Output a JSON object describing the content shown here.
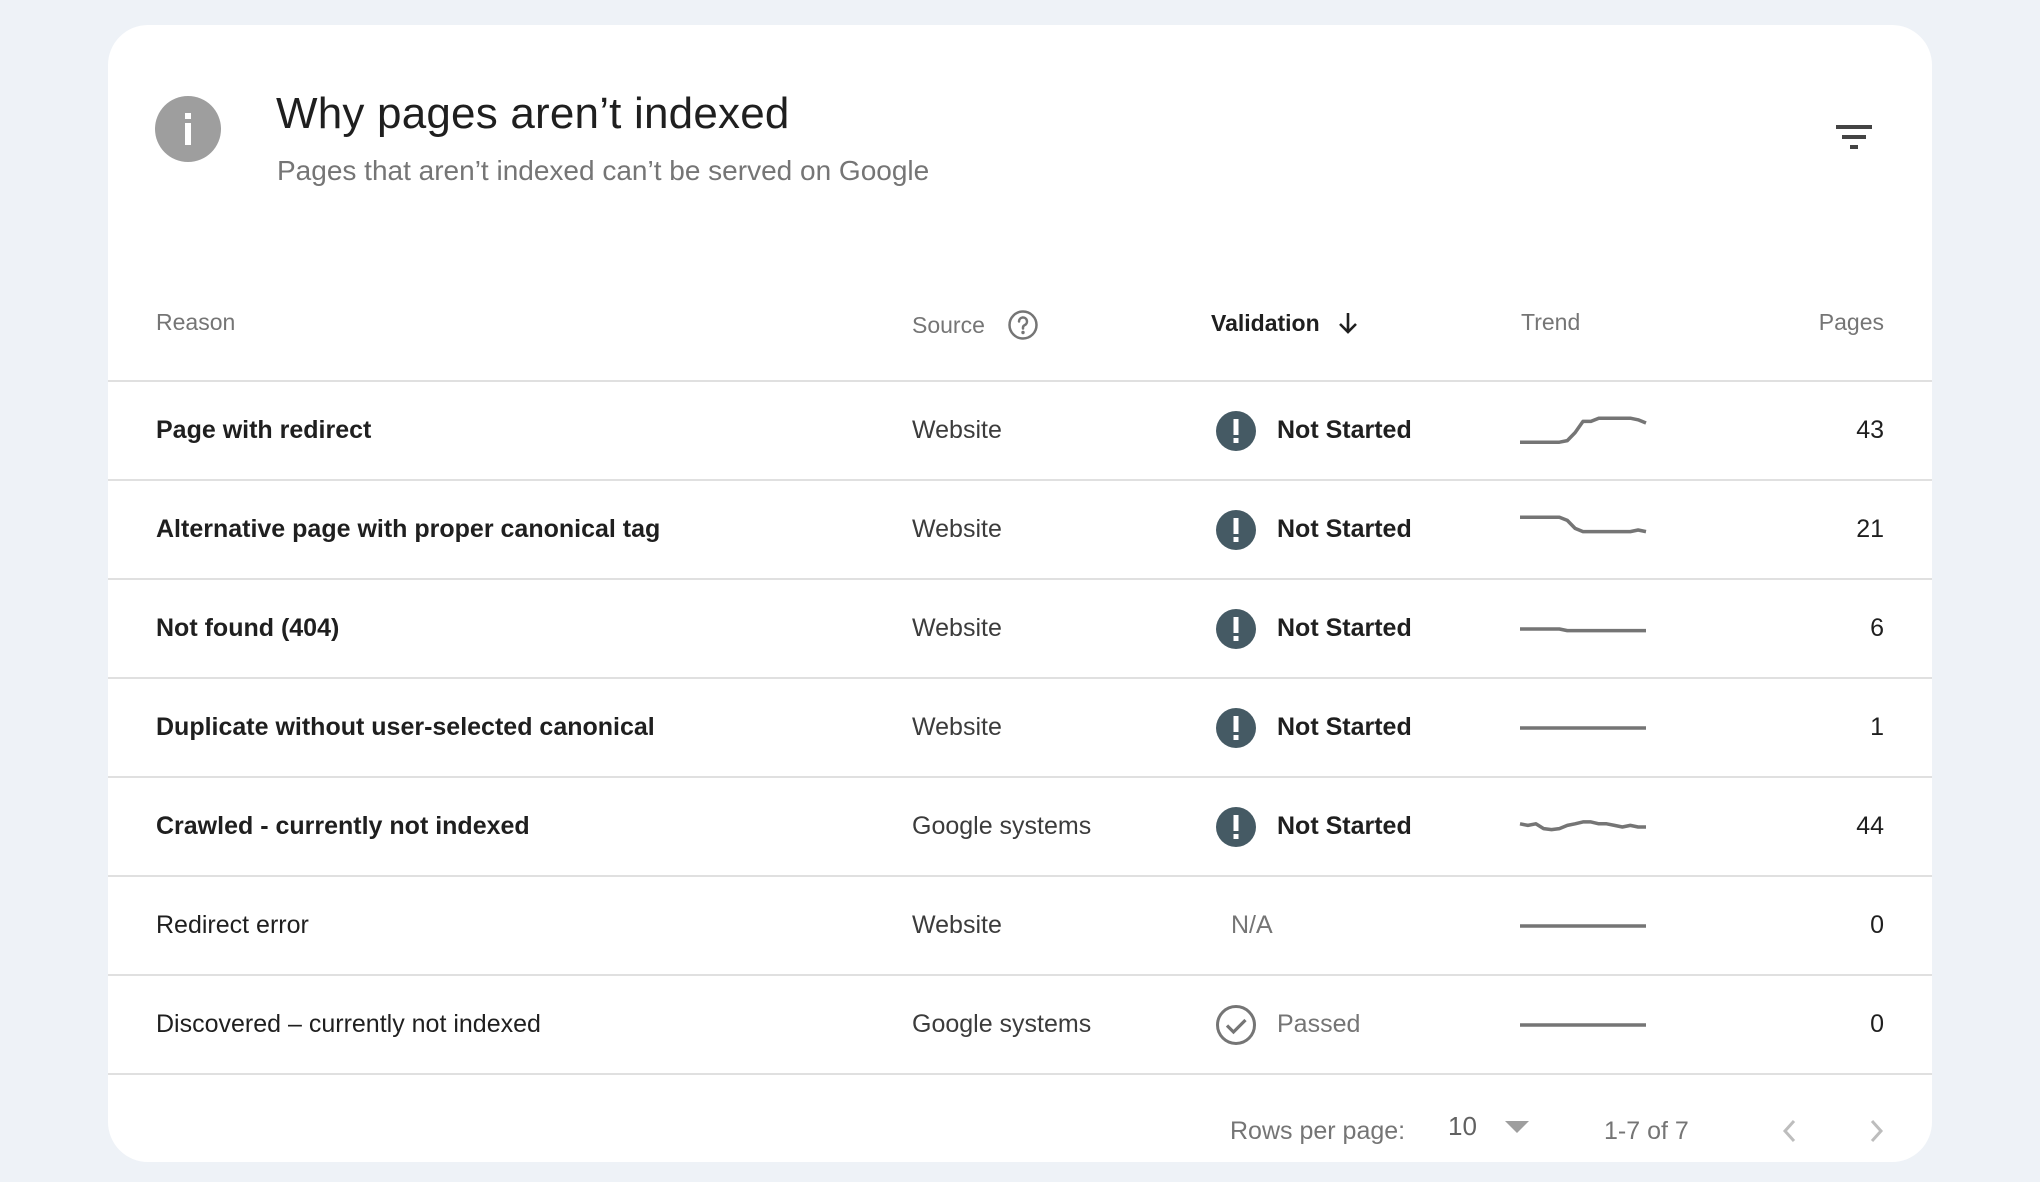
{
  "header": {
    "icon": "info-icon",
    "title": "Why pages aren’t indexed",
    "subtitle": "Pages that aren’t indexed can’t be served on Google",
    "filter_icon": "filter-icon"
  },
  "table": {
    "columns": {
      "reason": "Reason",
      "source": "Source",
      "validation": "Validation",
      "trend": "Trend",
      "pages": "Pages"
    },
    "sorted_by": "validation",
    "sort_direction": "descending",
    "rows": [
      {
        "reason": "Page with redirect",
        "source": "Website",
        "validation": "Not Started",
        "status": "not-started",
        "pages": "43",
        "trend": [
          0.15,
          0.15,
          0.15,
          0.15,
          0.15,
          0.15,
          0.2,
          0.45,
          0.8,
          0.8,
          0.9,
          0.9,
          0.9,
          0.9,
          0.9,
          0.85,
          0.75
        ]
      },
      {
        "reason": "Alternative page with proper canonical tag",
        "source": "Website",
        "validation": "Not Started",
        "status": "not-started",
        "pages": "21",
        "trend": [
          0.9,
          0.9,
          0.9,
          0.9,
          0.9,
          0.9,
          0.8,
          0.55,
          0.45,
          0.45,
          0.45,
          0.45,
          0.45,
          0.45,
          0.45,
          0.5,
          0.45
        ]
      },
      {
        "reason": "Not found (404)",
        "source": "Website",
        "validation": "Not Started",
        "status": "not-started",
        "pages": "6",
        "trend": [
          0.5,
          0.5,
          0.5,
          0.5,
          0.5,
          0.5,
          0.45,
          0.45,
          0.45,
          0.45,
          0.45,
          0.45,
          0.45,
          0.45,
          0.45,
          0.45,
          0.45
        ]
      },
      {
        "reason": "Duplicate without user-selected canonical",
        "source": "Website",
        "validation": "Not Started",
        "status": "not-started",
        "pages": "1",
        "trend": [
          0.5,
          0.5,
          0.5,
          0.5,
          0.5,
          0.5,
          0.5,
          0.5,
          0.5,
          0.5,
          0.5,
          0.5,
          0.5,
          0.5,
          0.5,
          0.5,
          0.5
        ]
      },
      {
        "reason": "Crawled - currently not indexed",
        "source": "Google systems",
        "validation": "Not Started",
        "status": "not-started",
        "pages": "44",
        "trend": [
          0.6,
          0.55,
          0.6,
          0.45,
          0.42,
          0.45,
          0.55,
          0.6,
          0.66,
          0.66,
          0.6,
          0.6,
          0.55,
          0.5,
          0.55,
          0.5,
          0.5
        ]
      },
      {
        "reason": "Redirect error",
        "source": "Website",
        "validation": "N/A",
        "status": "na",
        "pages": "0",
        "trend": [
          0.5,
          0.5,
          0.5,
          0.5,
          0.5,
          0.5,
          0.5,
          0.5,
          0.5,
          0.5,
          0.5,
          0.5,
          0.5,
          0.5,
          0.5,
          0.5,
          0.5
        ]
      },
      {
        "reason": "Discovered – currently not indexed",
        "source": "Google systems",
        "validation": "Passed",
        "status": "passed",
        "pages": "0",
        "trend": [
          0.5,
          0.5,
          0.5,
          0.5,
          0.5,
          0.5,
          0.5,
          0.5,
          0.5,
          0.5,
          0.5,
          0.5,
          0.5,
          0.5,
          0.5,
          0.5,
          0.5
        ]
      }
    ]
  },
  "pagination": {
    "rows_per_page_label": "Rows per page:",
    "rows_per_page_value": "10",
    "range": "1-7 of 7",
    "prev_icon": "chevron-left-icon",
    "next_icon": "chevron-right-icon"
  },
  "colors": {
    "background": "#eef2f7",
    "card": "#ffffff",
    "status_not_started": "#455a64",
    "status_passed": "#757575",
    "sparkline": "#757575",
    "info_icon": "#9e9e9e"
  }
}
